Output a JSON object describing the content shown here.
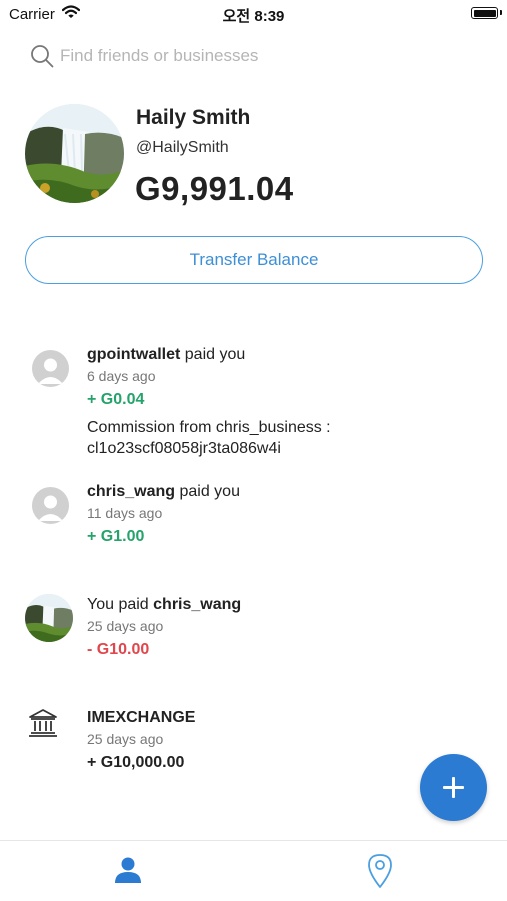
{
  "status_bar": {
    "carrier": "Carrier",
    "time": "오전 8:39"
  },
  "search": {
    "placeholder": "Find friends or businesses"
  },
  "profile": {
    "name": "Haily Smith",
    "handle": "@HailySmith",
    "balance": "G9,991.04"
  },
  "transfer_button": {
    "label": "Transfer Balance"
  },
  "feed": [
    {
      "user": "gpointwallet",
      "action": "paid you",
      "time": "6 days ago",
      "amount": "+ G0.04",
      "note_line1": "Commission from chris_business :",
      "note_line2": "cl1o23scf08058jr3ta086w4i"
    },
    {
      "user": "chris_wang",
      "action": "paid you",
      "time": "11 days ago",
      "amount": "+ G1.00"
    },
    {
      "prefix": "You paid",
      "user": "chris_wang",
      "time": "25 days ago",
      "amount": "- G10.00"
    },
    {
      "user": "IMEXCHANGE",
      "time": "25 days ago",
      "amount": "+ G10,000.00"
    }
  ],
  "colors": {
    "accent": "#2a7bd1",
    "positive": "#25a36a",
    "negative": "#e0464c"
  },
  "tab_bar": {
    "icons": [
      "person-icon",
      "location-pin-icon"
    ]
  },
  "fab": {
    "icon": "plus-icon"
  }
}
